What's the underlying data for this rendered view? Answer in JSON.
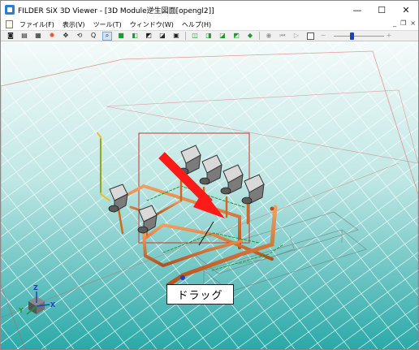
{
  "window": {
    "title": "FILDER SiX 3D Viewer - [3D Module逆生図面[opengl2]]",
    "minimize_label": "—",
    "maximize_label": "☐",
    "close_label": "✕"
  },
  "menubar": {
    "items": [
      {
        "label": "ファイル(F)"
      },
      {
        "label": "表示(V)"
      },
      {
        "label": "ツール(T)"
      },
      {
        "label": "ウィンドウ(W)"
      },
      {
        "label": "ヘルプ(H)"
      }
    ],
    "mdi_minimize": "_",
    "mdi_restore": "❐",
    "mdi_close": "×"
  },
  "toolbar": {
    "icons": [
      "camera-icon",
      "print-icon",
      "grid-icon",
      "pinwheel-icon",
      "move-icon",
      "rotate-zoom-icon",
      "zoom-icon",
      "zoom-window-icon",
      "cube-icon-1",
      "cube-icon-2",
      "cube-icon-3",
      "cube-icon-4",
      "cube-icon-5",
      "cube-icon-6",
      "cube-icon-7",
      "cube-icon-8",
      "cube-icon-9",
      "diamond-icon",
      "record-icon",
      "skip-start-icon",
      "play-icon",
      "stop-icon",
      "zoom-minus-icon",
      "zoom-plus-icon"
    ],
    "slider_level": 0.35,
    "colors": {
      "accent": "#1f3fbf",
      "green": "#1c9a2e"
    }
  },
  "viewport": {
    "callout_text": "ドラッグ",
    "axis_labels": {
      "z": "Z",
      "y": "Y",
      "x": "X"
    },
    "colors": {
      "background_top": "#f4fbfa",
      "background_bottom": "#1fa7a6",
      "grid": "#ffffff",
      "floor_boundary": "#e24a4a",
      "selection_box": "#c0392b",
      "arrow": "#ff1a1a",
      "pipe": "#d2691e"
    }
  }
}
